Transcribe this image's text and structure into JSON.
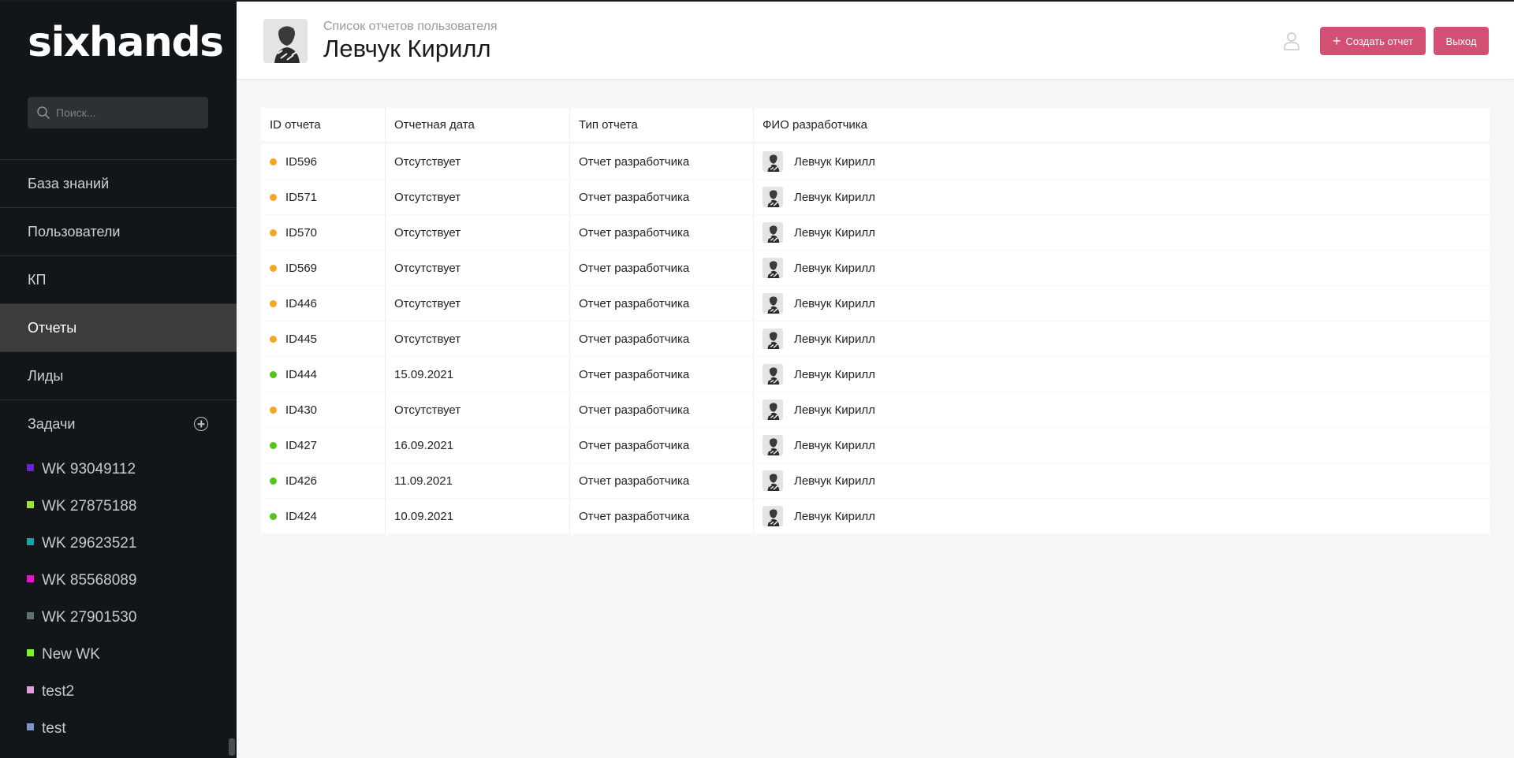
{
  "sidebar": {
    "logo": "sixhands",
    "search_placeholder": "Поиск...",
    "nav": [
      {
        "label": "База знаний",
        "active": false
      },
      {
        "label": "Пользователи",
        "active": false
      },
      {
        "label": "КП",
        "active": false
      },
      {
        "label": "Отчеты",
        "active": true
      },
      {
        "label": "Лиды",
        "active": false
      }
    ],
    "tasks_label": "Задачи",
    "tasks": [
      {
        "label": "WK 93049112",
        "color": "#6a22e0"
      },
      {
        "label": "WK 27875188",
        "color": "#9be04a"
      },
      {
        "label": "WK 29623521",
        "color": "#16a6a6"
      },
      {
        "label": "WK 85568089",
        "color": "#e015d0"
      },
      {
        "label": "WK 27901530",
        "color": "#5f7470"
      },
      {
        "label": "New WK",
        "color": "#7ef22a"
      },
      {
        "label": "test2",
        "color": "#e49ee0"
      },
      {
        "label": "test",
        "color": "#7f94c9"
      }
    ]
  },
  "header": {
    "subtitle": "Список отчетов пользователя",
    "title": "Левчук Кирилл",
    "create_button": "Создать отчет",
    "exit_button": "Выход"
  },
  "table": {
    "columns": [
      "ID отчета",
      "Отчетная дата",
      "Тип отчета",
      "ФИО разработчика"
    ],
    "rows": [
      {
        "id": "ID596",
        "date": "Отсутствует",
        "type": "Отчет разработчика",
        "developer": "Левчук Кирилл",
        "status": "pending"
      },
      {
        "id": "ID571",
        "date": "Отсутствует",
        "type": "Отчет разработчика",
        "developer": "Левчук Кирилл",
        "status": "pending"
      },
      {
        "id": "ID570",
        "date": "Отсутствует",
        "type": "Отчет разработчика",
        "developer": "Левчук Кирилл",
        "status": "pending"
      },
      {
        "id": "ID569",
        "date": "Отсутствует",
        "type": "Отчет разработчика",
        "developer": "Левчук Кирилл",
        "status": "pending"
      },
      {
        "id": "ID446",
        "date": "Отсутствует",
        "type": "Отчет разработчика",
        "developer": "Левчук Кирилл",
        "status": "pending"
      },
      {
        "id": "ID445",
        "date": "Отсутствует",
        "type": "Отчет разработчика",
        "developer": "Левчук Кирилл",
        "status": "pending"
      },
      {
        "id": "ID444",
        "date": "15.09.2021",
        "type": "Отчет разработчика",
        "developer": "Левчук Кирилл",
        "status": "done"
      },
      {
        "id": "ID430",
        "date": "Отсутствует",
        "type": "Отчет разработчика",
        "developer": "Левчук Кирилл",
        "status": "pending"
      },
      {
        "id": "ID427",
        "date": "16.09.2021",
        "type": "Отчет разработчика",
        "developer": "Левчук Кирилл",
        "status": "done"
      },
      {
        "id": "ID426",
        "date": "11.09.2021",
        "type": "Отчет разработчика",
        "developer": "Левчук Кирилл",
        "status": "done"
      },
      {
        "id": "ID424",
        "date": "10.09.2021",
        "type": "Отчет разработчика",
        "developer": "Левчук Кирилл",
        "status": "done"
      }
    ]
  },
  "colors": {
    "accent": "#d34f73",
    "sidebar_bg": "#131619",
    "status_pending": "#f5a623",
    "status_done": "#52c41a"
  },
  "icons": {
    "search": "search-icon",
    "user": "user-outline-icon",
    "add_task": "plus-circle-icon",
    "create": "plus-icon"
  }
}
